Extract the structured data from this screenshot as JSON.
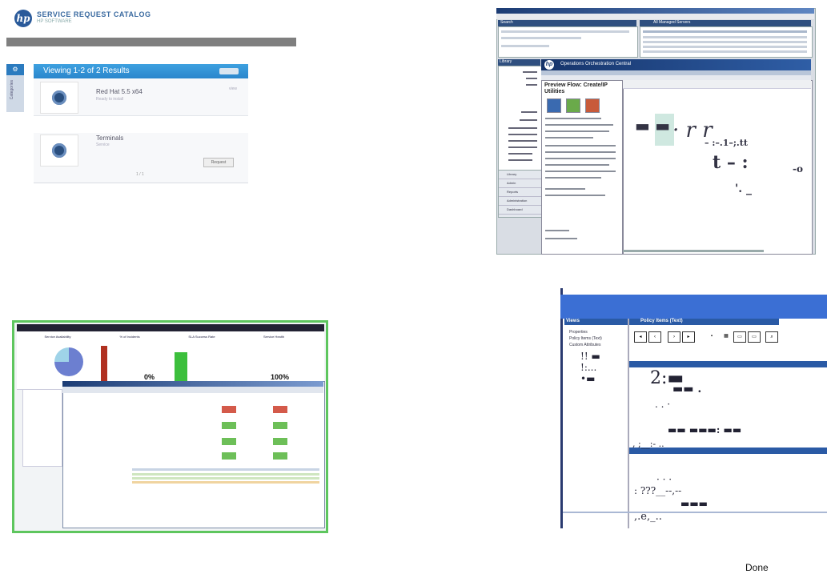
{
  "panel_a": {
    "brand": "SERVICE REQUEST CATALOG",
    "brand_sub": "HP SOFTWARE",
    "results_title": "Viewing 1-2 of 2 Results",
    "items": [
      {
        "title": "Red Hat 5.5 x64",
        "subtitle": "Ready to install",
        "tag": "view"
      },
      {
        "title": "Terminals",
        "subtitle": "Service"
      }
    ],
    "request_button": "Request",
    "side_tab": "Categories",
    "pager": "1 / 1"
  },
  "panel_b": {
    "search_label": "Search",
    "managed_label": "All Managed Servers",
    "tree_label": "Library",
    "app_title": "Operations Orchestration Central",
    "preview_title": "Preview Flow: Create/IP Utilities",
    "nav_items": [
      "Library",
      "Admin",
      "Reports",
      "Administration",
      "Dashboard"
    ]
  },
  "panel_c": {
    "kpi": [
      {
        "title": "Service Availability",
        "value": ""
      },
      {
        "title": "% of Incidents",
        "value": "0%"
      },
      {
        "title": "SLA Success Rate",
        "value": ""
      },
      {
        "title": "Service Health",
        "value": "100%"
      }
    ]
  },
  "panel_d": {
    "views_label": "Views",
    "policy_label": "Policy Items (Text)",
    "view_items": [
      "Properties",
      "Policy Items (Text)",
      "Custom Attributes"
    ]
  },
  "status": {
    "done": "Done"
  }
}
